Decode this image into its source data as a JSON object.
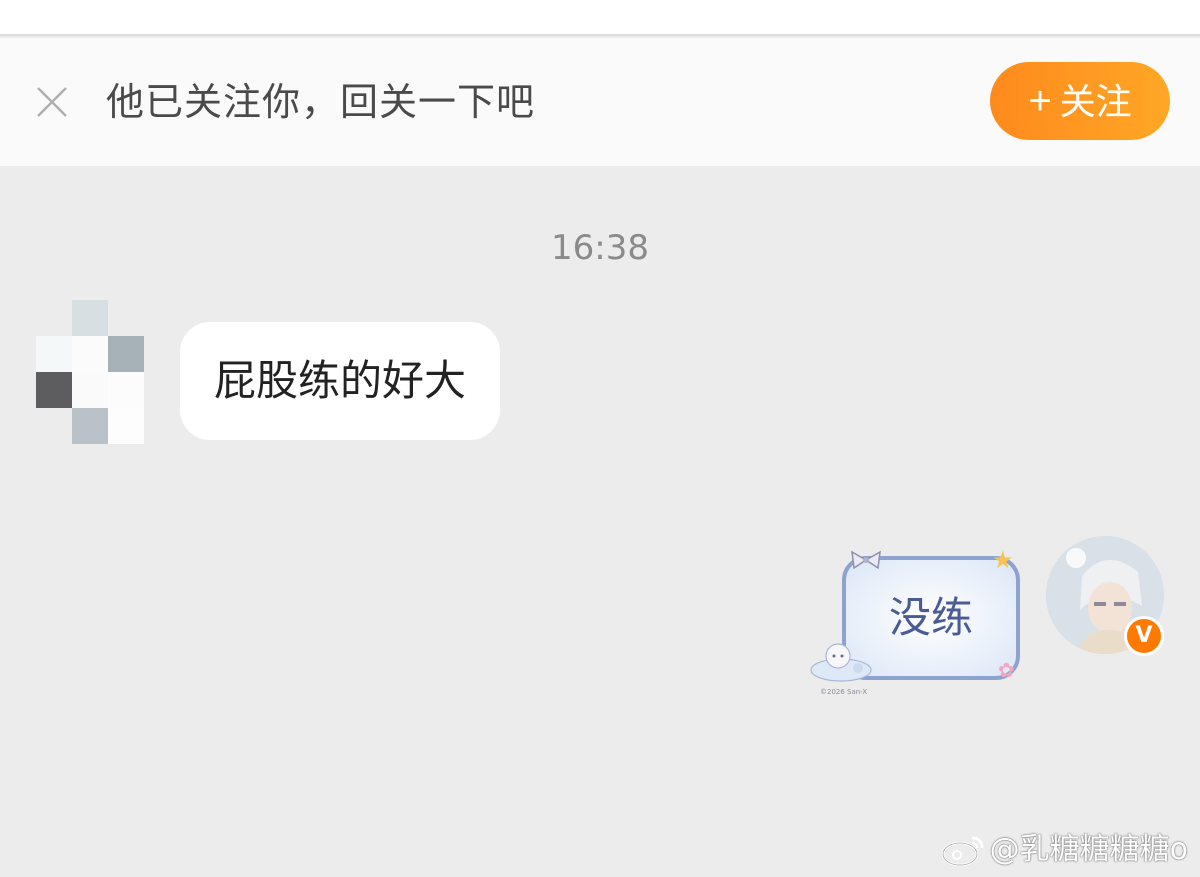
{
  "follow_banner": {
    "text": "他已关注你，回关一下吧",
    "button_label": "关注",
    "plus_icon": "+",
    "accent_color": "#ff8a1c"
  },
  "conversation": {
    "timestamp": "16:38",
    "messages": [
      {
        "side": "left",
        "text": "屁股练的好大"
      },
      {
        "side": "right",
        "text": "没练",
        "sticker_copyright": "©2026 San-X"
      }
    ]
  },
  "badge": {
    "label": "V",
    "color": "#ff7a00"
  },
  "watermark": {
    "text": "@乳糖糖糖糖o",
    "icon": "weibo-logo-icon"
  }
}
